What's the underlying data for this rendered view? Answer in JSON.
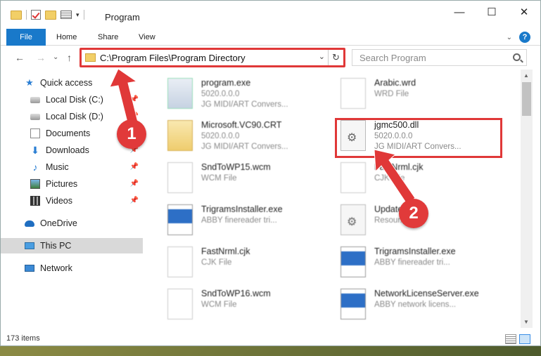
{
  "window": {
    "title": "Program",
    "controls": {
      "minimize": "—",
      "maximize": "☐",
      "close": "✕"
    }
  },
  "ribbon": {
    "tabs": [
      "File",
      "Home",
      "Share",
      "View"
    ],
    "help": "?"
  },
  "nav": {
    "back": "←",
    "forward": "→",
    "up": "↑",
    "address": "C:\\Program Files\\Program Directory",
    "refresh": "↻",
    "search_placeholder": "Search Program"
  },
  "sidebar": {
    "items": [
      {
        "label": "Quick access",
        "icon": "star-icon",
        "pinned": false
      },
      {
        "label": "Local Disk (C:)",
        "icon": "disk-icon",
        "pinned": true
      },
      {
        "label": "Local Disk (D:)",
        "icon": "disk-icon",
        "pinned": true
      },
      {
        "label": "Documents",
        "icon": "documents-icon",
        "pinned": true
      },
      {
        "label": "Downloads",
        "icon": "download-icon",
        "pinned": true
      },
      {
        "label": "Music",
        "icon": "music-icon",
        "pinned": true
      },
      {
        "label": "Pictures",
        "icon": "pictures-icon",
        "pinned": true
      },
      {
        "label": "Videos",
        "icon": "videos-icon",
        "pinned": true
      },
      {
        "label": "OneDrive",
        "icon": "onedrive-icon",
        "pinned": false
      },
      {
        "label": "This PC",
        "icon": "pc-icon",
        "pinned": false,
        "selected": true
      },
      {
        "label": "Network",
        "icon": "network-icon",
        "pinned": false
      }
    ]
  },
  "files": [
    {
      "name": "program.exe",
      "line2": "5020.0.0.0",
      "line3": "JG MIDI/ART Convers...",
      "icon": "exe-icon"
    },
    {
      "name": "Arabic.wrd",
      "line2": "WRD File",
      "line3": "",
      "icon": "file-icon"
    },
    {
      "name": "Microsoft.VC90.CRT",
      "line2": "5020.0.0.0",
      "line3": "JG MIDI/ART Convers...",
      "icon": "folder-icon"
    },
    {
      "name": "jgmc500.dll",
      "line2": "5020.0.0.0",
      "line3": "JG MIDI/ART Convers...",
      "icon": "dll-gear-icon",
      "highlighted": true
    },
    {
      "name": "SndToWP15.wcm",
      "line2": "WCM File",
      "line3": "",
      "icon": "file-icon"
    },
    {
      "name": "FastNrml.cjk",
      "line2": "CJK File",
      "line3": "",
      "icon": "file-icon"
    },
    {
      "name": "TrigramsInstaller.exe",
      "line2": "ABBY finereader tri...",
      "line3": "",
      "icon": "window-icon"
    },
    {
      "name": "Update...5.dll",
      "line2": "Resour...",
      "line3": "",
      "icon": "dll-gear-icon"
    },
    {
      "name": "FastNrml.cjk",
      "line2": "CJK File",
      "line3": "",
      "icon": "file-icon"
    },
    {
      "name": "TrigramsInstaller.exe",
      "line2": "ABBY finereader tri...",
      "line3": "",
      "icon": "window-icon"
    },
    {
      "name": "SndToWP16.wcm",
      "line2": "WCM File",
      "line3": "",
      "icon": "file-icon"
    },
    {
      "name": "NetworkLicenseServer.exe",
      "line2": "ABBY network licens...",
      "line3": "",
      "icon": "window-icon"
    }
  ],
  "status": {
    "count": "173 items"
  },
  "annotations": {
    "marker1": "1",
    "marker2": "2"
  },
  "colors": {
    "accent": "#1979ca",
    "annotation": "#e03838"
  }
}
